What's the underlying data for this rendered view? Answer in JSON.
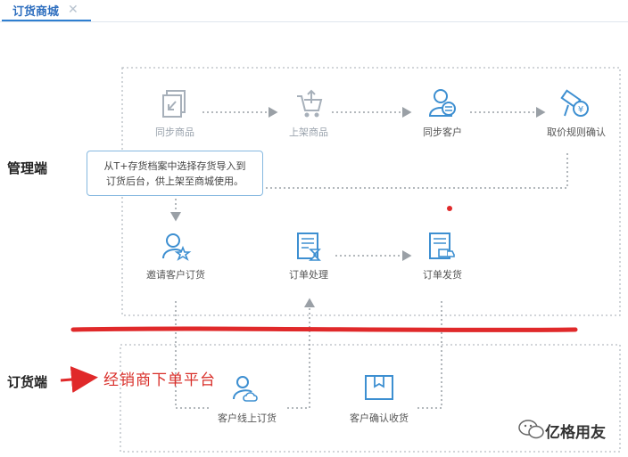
{
  "tab": {
    "label": "订货商城",
    "close": "✕"
  },
  "sections": {
    "admin": "管理端",
    "order": "订货端"
  },
  "nodes": {
    "sync_goods": "同步商品",
    "list_goods": "上架商品",
    "sync_customers": "同步客户",
    "price_rule": "取价规则确认",
    "invite": "邀请客户订货",
    "order_process": "订单处理",
    "order_ship": "订单发货",
    "online_order": "客户线上订货",
    "confirm_receipt": "客户确认收货"
  },
  "callout": {
    "line1": "从T+存货档案中选择存货导入到",
    "line2": "订货后台，供上架至商城使用。"
  },
  "annotation": "经销商下单平台",
  "watermark": "亿格用友",
  "colors": {
    "icon_blue": "#3d8fd1",
    "icon_grey": "#a7b0ba",
    "red": "#e0292a",
    "dotted": "#b7bcc2"
  }
}
